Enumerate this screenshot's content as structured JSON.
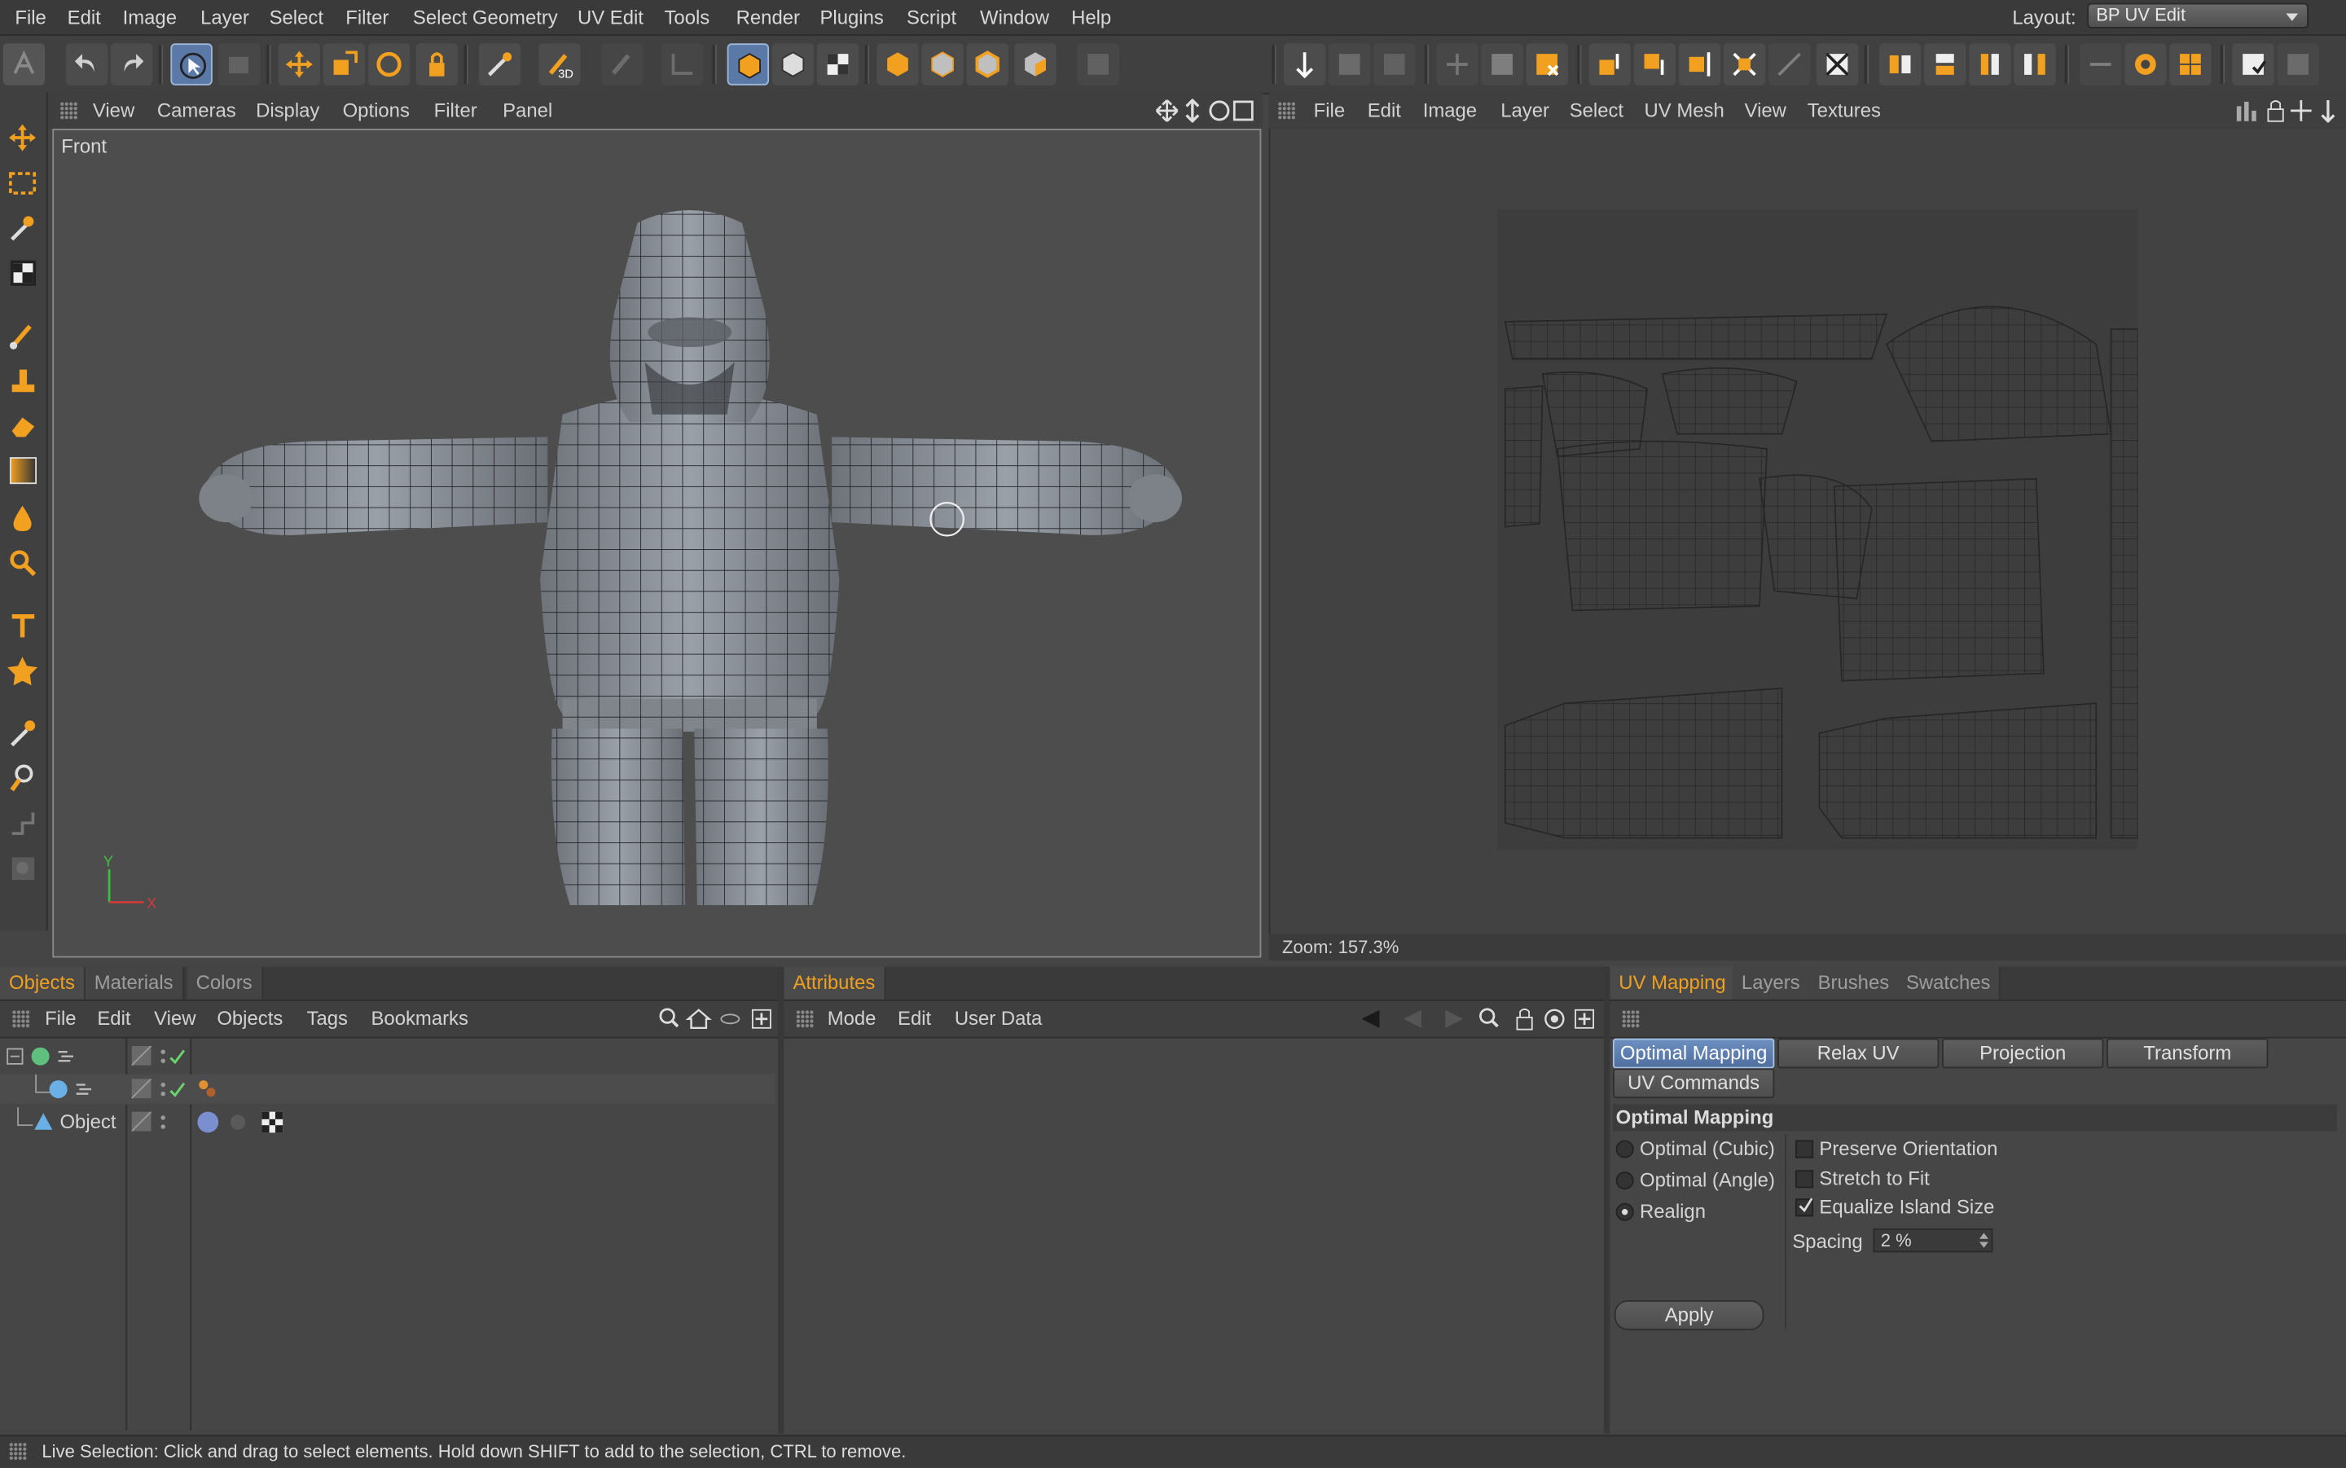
{
  "menubar": {
    "items": [
      "File",
      "Edit",
      "Image",
      "Layer",
      "Select",
      "Filter",
      "Select Geometry",
      "UV Edit",
      "Tools",
      "Render",
      "Plugins",
      "Script",
      "Window",
      "Help"
    ],
    "layout_label": "Layout:",
    "layout_value": "BP UV Edit"
  },
  "viewport": {
    "menu": [
      "View",
      "Cameras",
      "Display",
      "Options",
      "Filter",
      "Panel"
    ],
    "view_name": "Front",
    "axis_y": "Y",
    "axis_x": "X"
  },
  "uv_editor": {
    "menu": [
      "File",
      "Edit",
      "Image",
      "Layer",
      "Select",
      "UV Mesh",
      "View",
      "Textures"
    ],
    "zoom": "Zoom: 157.3%"
  },
  "objects_panel": {
    "tabs": [
      "Objects",
      "Materials",
      "Colors"
    ],
    "menu": [
      "File",
      "Edit",
      "View",
      "Objects",
      "Tags",
      "Bookmarks"
    ],
    "tree": [
      "",
      "",
      "Object"
    ]
  },
  "attributes_panel": {
    "tab": "Attributes",
    "menu": [
      "Mode",
      "Edit",
      "User Data"
    ]
  },
  "uv_panel": {
    "tabs": [
      "UV Mapping",
      "Layers",
      "Brushes",
      "Swatches"
    ],
    "buttons": [
      "Optimal Mapping",
      "Relax UV",
      "Projection",
      "Transform",
      "UV Commands"
    ],
    "section_title": "Optimal Mapping",
    "radios": [
      {
        "label": "Optimal (Cubic)",
        "checked": false
      },
      {
        "label": "Optimal (Angle)",
        "checked": false
      },
      {
        "label": "Realign",
        "checked": true
      }
    ],
    "checkboxes": [
      {
        "label": "Preserve Orientation",
        "checked": false
      },
      {
        "label": "Stretch to Fit",
        "checked": false
      },
      {
        "label": "Equalize Island Size",
        "checked": true
      }
    ],
    "spacing_label": "Spacing",
    "spacing_value": "2 %",
    "apply_label": "Apply"
  },
  "status": "Live Selection: Click and drag to select elements. Hold down SHIFT to add to the selection, CTRL to remove.",
  "colors": {
    "accent": "#f0a020",
    "selection_blue": "#5a79a6"
  }
}
